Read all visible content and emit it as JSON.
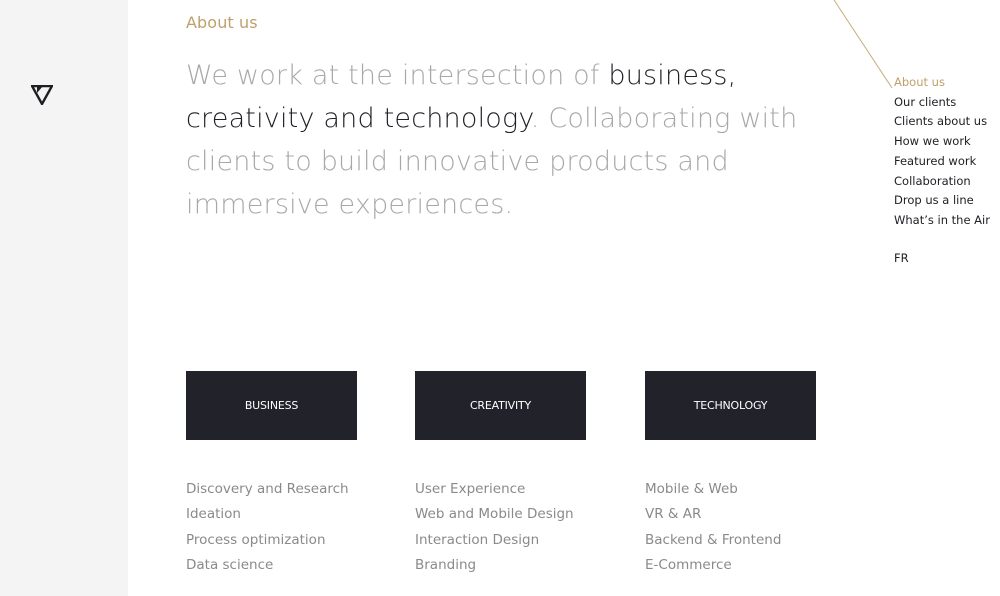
{
  "section_label": "About us",
  "headline": {
    "part1": "We work at the intersection of ",
    "part2": "business, creativity and technology",
    "part3": ". Collaborating with clients to build innovative products and immersive experiences."
  },
  "nav": {
    "items": [
      {
        "label": "About us",
        "active": true
      },
      {
        "label": "Our clients"
      },
      {
        "label": "Clients about us"
      },
      {
        "label": "How we work"
      },
      {
        "label": "Featured work"
      },
      {
        "label": "Collaboration"
      },
      {
        "label": "Drop us a line"
      },
      {
        "label": "What’s in the Air"
      }
    ],
    "language": "FR"
  },
  "pillars": [
    {
      "title": "BUSINESS",
      "items": [
        "Discovery and Research",
        "Ideation",
        "Process optimization",
        "Data science"
      ]
    },
    {
      "title": "CREATIVITY",
      "items": [
        "User Experience",
        "Web and Mobile Design",
        "Interaction Design",
        "Branding"
      ]
    },
    {
      "title": "TECHNOLOGY",
      "items": [
        "Mobile & Web",
        "VR & AR",
        "Backend & Frontend",
        "E-Commerce"
      ]
    }
  ],
  "colors": {
    "accent": "#bfa06b",
    "dark": "#1e1e24",
    "box": "#22222b",
    "muted_text": "#a8a8a8",
    "rail": "#f4f4f4"
  },
  "icons": [
    "brand-logo-icon"
  ]
}
